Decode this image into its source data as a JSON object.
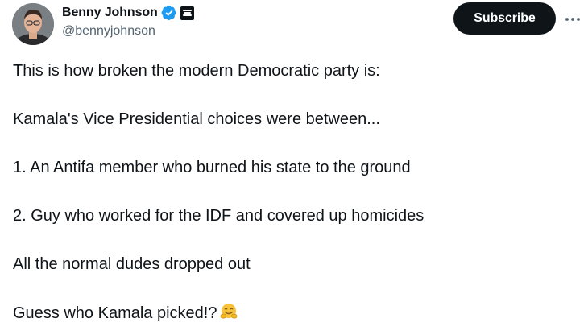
{
  "author": {
    "display_name": "Benny Johnson",
    "handle": "@bennyjohnson",
    "avatar": "avatar-photo",
    "verified_icon": "verified-badge-icon",
    "affiliate_icon": "affiliate-badge-icon",
    "accent_color": "#1d9bf0"
  },
  "actions": {
    "subscribe_label": "Subscribe",
    "more_icon": "more-horizontal-icon"
  },
  "post": {
    "lines": [
      "This is how broken the modern Democratic party is:",
      "Kamala's Vice Presidential choices were between...",
      "1. An Antifa member who burned his state to the ground",
      "2. Guy who worked for the IDF and covered up homicides",
      "All the normal dudes dropped out",
      "Guess who Kamala picked!?"
    ],
    "emoji_icon": "hugging-face-emoji-icon"
  }
}
